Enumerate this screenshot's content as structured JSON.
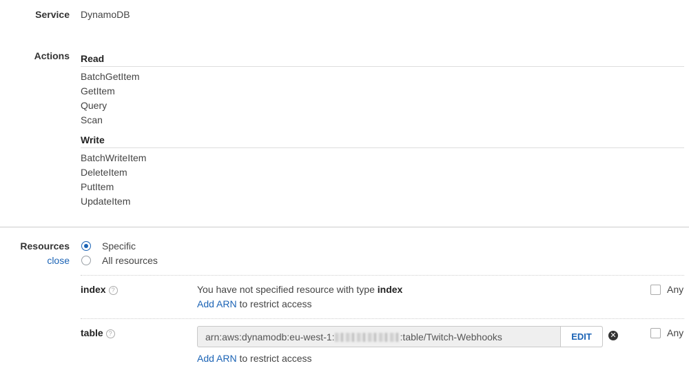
{
  "service": {
    "label": "Service",
    "value": "DynamoDB"
  },
  "actions": {
    "label": "Actions",
    "groups": [
      {
        "title": "Read",
        "items": [
          "BatchGetItem",
          "GetItem",
          "Query",
          "Scan"
        ]
      },
      {
        "title": "Write",
        "items": [
          "BatchWriteItem",
          "DeleteItem",
          "PutItem",
          "UpdateItem"
        ]
      }
    ]
  },
  "resources": {
    "label": "Resources",
    "close_link": "close",
    "options": [
      {
        "label": "Specific",
        "selected": true
      },
      {
        "label": "All resources",
        "selected": false
      }
    ],
    "rows": [
      {
        "name": "index",
        "help_icon": "question-circle-icon",
        "message_prefix": "You have not specified resource with type ",
        "message_type": "index",
        "add_arn_link": "Add ARN",
        "add_arn_suffix": " to restrict access",
        "any_label": "Any",
        "any_checked": false
      },
      {
        "name": "table",
        "help_icon": "question-circle-icon",
        "arn_prefix": "arn:aws:dynamodb:eu-west-1:",
        "arn_suffix": ":table/Twitch-Webhooks",
        "edit_label": "EDIT",
        "remove_icon": "remove-circle-icon",
        "add_arn_link": "Add ARN",
        "add_arn_suffix": " to restrict access",
        "any_label": "Any",
        "any_checked": false
      }
    ]
  },
  "colors": {
    "link": "#1b63b5",
    "divider": "#dddddd",
    "text": "#444444"
  }
}
